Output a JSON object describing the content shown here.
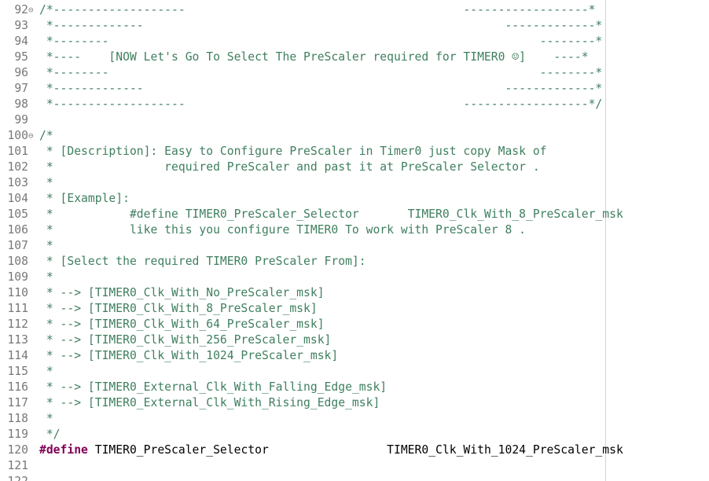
{
  "editor": {
    "lines": [
      {
        "num": "92",
        "fold": "⊖",
        "text": "/*-------------------                                        ------------------*"
      },
      {
        "num": "93",
        "fold": "",
        "text": " *-------------                                                    -------------*"
      },
      {
        "num": "94",
        "fold": "",
        "text": " *--------                                                              --------*"
      },
      {
        "num": "95",
        "fold": "",
        "text": " *----    [NOW Let's Go To Select The PreScaler required for TIMER0 ☺]    ----*"
      },
      {
        "num": "96",
        "fold": "",
        "text": " *--------                                                              --------*"
      },
      {
        "num": "97",
        "fold": "",
        "text": " *-------------                                                    -------------*"
      },
      {
        "num": "98",
        "fold": "",
        "text": " *-------------------                                        ------------------*/"
      },
      {
        "num": "99",
        "fold": "",
        "text": ""
      },
      {
        "num": "100",
        "fold": "⊖",
        "text": "/*"
      },
      {
        "num": "101",
        "fold": "",
        "text": " * [Description]: Easy to Configure PreScaler in Timer0 just copy Mask of"
      },
      {
        "num": "102",
        "fold": "",
        "text": " *                required PreScaler and past it at PreScaler Selector ."
      },
      {
        "num": "103",
        "fold": "",
        "text": " *"
      },
      {
        "num": "104",
        "fold": "",
        "text": " * [Example]:"
      },
      {
        "num": "105",
        "fold": "",
        "text": " *           #define TIMER0_PreScaler_Selector       TIMER0_Clk_With_8_PreScaler_msk"
      },
      {
        "num": "106",
        "fold": "",
        "text": " *           like this you configure TIMER0 To work with PreScaler 8 ."
      },
      {
        "num": "107",
        "fold": "",
        "text": " *"
      },
      {
        "num": "108",
        "fold": "",
        "text": " * [Select the required TIMER0 PreScaler From]:"
      },
      {
        "num": "109",
        "fold": "",
        "text": " *"
      },
      {
        "num": "110",
        "fold": "",
        "text": " * --> [TIMER0_Clk_With_No_PreScaler_msk]"
      },
      {
        "num": "111",
        "fold": "",
        "text": " * --> [TIMER0_Clk_With_8_PreScaler_msk]"
      },
      {
        "num": "112",
        "fold": "",
        "text": " * --> [TIMER0_Clk_With_64_PreScaler_msk]"
      },
      {
        "num": "113",
        "fold": "",
        "text": " * --> [TIMER0_Clk_With_256_PreScaler_msk]"
      },
      {
        "num": "114",
        "fold": "",
        "text": " * --> [TIMER0_Clk_With_1024_PreScaler_msk]"
      },
      {
        "num": "115",
        "fold": "",
        "text": " *"
      },
      {
        "num": "116",
        "fold": "",
        "text": " * --> [TIMER0_External_Clk_With_Falling_Edge_msk]"
      },
      {
        "num": "117",
        "fold": "",
        "text": " * --> [TIMER0_External_Clk_With_Rising_Edge_msk]"
      },
      {
        "num": "118",
        "fold": "",
        "text": " *"
      },
      {
        "num": "119",
        "fold": "",
        "text": " */"
      },
      {
        "num": "121",
        "fold": "",
        "text": ""
      },
      {
        "num": "122",
        "fold": "",
        "text": ""
      }
    ],
    "define_line": {
      "num": "120",
      "keyword": "#define",
      "name": " TIMER0_PreScaler_Selector",
      "spacer": "                 ",
      "value": "TIMER0_Clk_With_1024_PreScaler_msk"
    },
    "colors": {
      "comment": "#3f7f5f",
      "keyword": "#7f0055",
      "line_number": "#787878",
      "print_margin": "#d4d4d4"
    }
  }
}
